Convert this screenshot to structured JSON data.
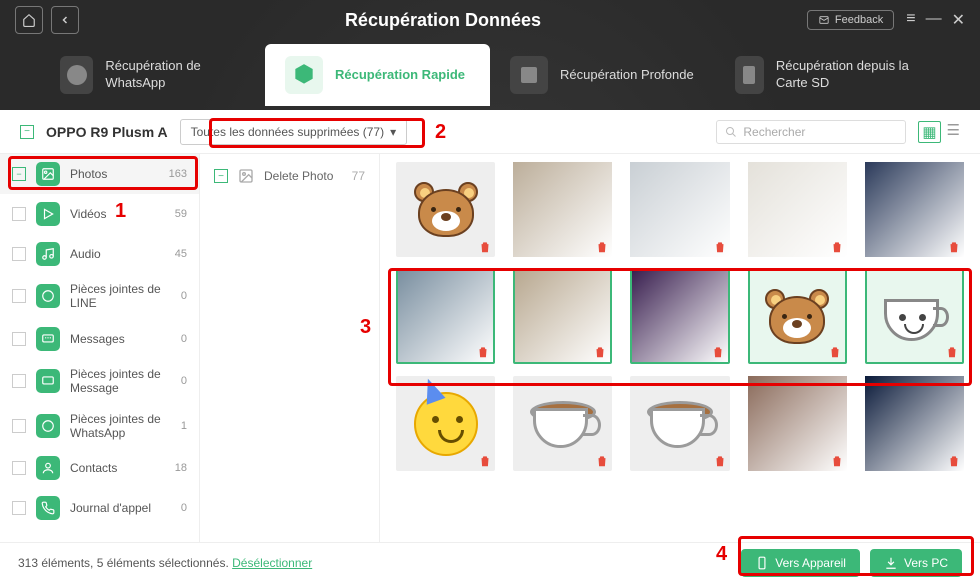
{
  "header": {
    "title": "Récupération Données",
    "feedback": "Feedback",
    "tabs": [
      {
        "label": "Récupération de WhatsApp"
      },
      {
        "label": "Récupération Rapide"
      },
      {
        "label": "Récupération Profonde"
      },
      {
        "label": "Récupération depuis la Carte SD"
      }
    ]
  },
  "toolbar": {
    "device": "OPPO R9 Plusm A",
    "filter": "Toutes les données supprimées (77)",
    "search_placeholder": "Rechercher"
  },
  "sidebar": [
    {
      "icon": "image",
      "color": "#3cb878",
      "label": "Photos",
      "count": "163",
      "active": true
    },
    {
      "icon": "play",
      "color": "#3cb878",
      "label": "Vidéos",
      "count": "59"
    },
    {
      "icon": "music",
      "color": "#3cb878",
      "label": "Audio",
      "count": "45"
    },
    {
      "icon": "line",
      "color": "#3cb878",
      "label": "Pièces jointes de LINE",
      "count": "0"
    },
    {
      "icon": "msg",
      "color": "#3cb878",
      "label": "Messages",
      "count": "0"
    },
    {
      "icon": "msgatt",
      "color": "#3cb878",
      "label": "Pièces jointes de Message",
      "count": "0"
    },
    {
      "icon": "wa",
      "color": "#3cb878",
      "label": "Pièces jointes de WhatsApp",
      "count": "1"
    },
    {
      "icon": "contact",
      "color": "#3cb878",
      "label": "Contacts",
      "count": "18"
    },
    {
      "icon": "call",
      "color": "#3cb878",
      "label": "Journal d'appel",
      "count": "0"
    }
  ],
  "subpanel": {
    "label": "Delete Photo",
    "count": "77"
  },
  "grid": {
    "rows": [
      [
        {
          "type": "bear",
          "sel": false
        },
        {
          "type": "photo",
          "c": "#bcae9a",
          "sel": false
        },
        {
          "type": "photo",
          "c": "#c9cfd4",
          "sel": false
        },
        {
          "type": "photo",
          "c": "#e4e1da",
          "sel": false
        },
        {
          "type": "photo",
          "c": "#2b3a5a",
          "sel": false
        }
      ],
      [
        {
          "type": "photo",
          "c": "#7a8fa0",
          "sel": true
        },
        {
          "type": "photo",
          "c": "#b8a890",
          "sel": true
        },
        {
          "type": "photo",
          "c": "#3a2050",
          "sel": true
        },
        {
          "type": "bear",
          "sel": true
        },
        {
          "type": "cupface",
          "sel": true
        }
      ],
      [
        {
          "type": "party",
          "sel": false
        },
        {
          "type": "cup",
          "sel": false
        },
        {
          "type": "cup",
          "sel": false
        },
        {
          "type": "photo",
          "c": "#8a6a5a",
          "sel": false
        },
        {
          "type": "photo",
          "c": "#0a1a3a",
          "sel": false
        }
      ]
    ]
  },
  "footer": {
    "status_a": "313 éléments, 5 éléments sélectionnés.",
    "deselect": "Désélectionner",
    "export_device": "Vers Appareil",
    "export_pc": "Vers PC"
  },
  "annotations": {
    "n1": "1",
    "n2": "2",
    "n3": "3",
    "n4": "4"
  }
}
